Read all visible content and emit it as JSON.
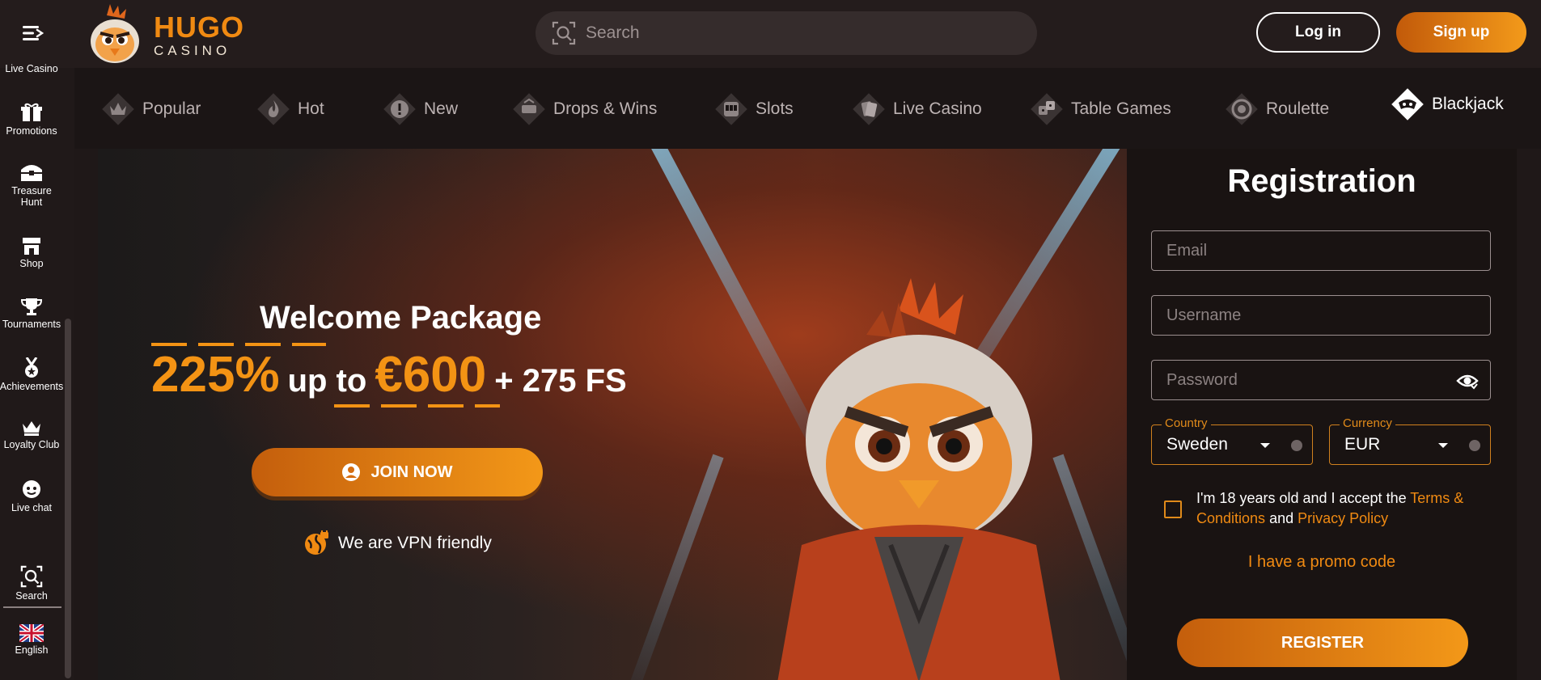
{
  "header": {
    "logo_hugo": "HUGO",
    "logo_casino": "CASINO",
    "search_placeholder": "Search",
    "login_label": "Log in",
    "signup_label": "Sign up"
  },
  "sidebar": {
    "partial_item": "Live Casino",
    "items": [
      {
        "label": "Promotions",
        "icon": "gift-icon"
      },
      {
        "label": "Treasure Hunt",
        "icon": "treasure-chest-icon"
      },
      {
        "label": "Shop",
        "icon": "shop-icon"
      },
      {
        "label": "Tournaments",
        "icon": "trophy-icon"
      },
      {
        "label": "Achievements",
        "icon": "medal-icon"
      },
      {
        "label": "Loyalty Club",
        "icon": "crown-icon"
      },
      {
        "label": "Live chat",
        "icon": "chat-icon"
      },
      {
        "label": "Search",
        "icon": "search-icon"
      },
      {
        "label": "English",
        "icon": "uk-flag-icon"
      }
    ]
  },
  "categories": [
    {
      "label": "Popular",
      "icon": "crown-diamond-icon"
    },
    {
      "label": "Hot",
      "icon": "flame-icon"
    },
    {
      "label": "New",
      "icon": "exclamation-icon"
    },
    {
      "label": "Drops & Wins",
      "icon": "drops-wins-icon"
    },
    {
      "label": "Slots",
      "icon": "slot-machine-icon"
    },
    {
      "label": "Live Casino",
      "icon": "cards-icon"
    },
    {
      "label": "Table Games",
      "icon": "dice-icon"
    },
    {
      "label": "Roulette",
      "icon": "roulette-icon"
    },
    {
      "label": "Blackjack",
      "icon": "blackjack-icon"
    }
  ],
  "hero": {
    "title": "Welcome Package",
    "offer_percent": "225%",
    "offer_up_to": "up to",
    "offer_amount": "€600",
    "offer_fs": "+ 275 FS",
    "join_label": "JOIN NOW",
    "vpn_text": "We are VPN friendly"
  },
  "registration": {
    "title": "Registration",
    "email_placeholder": "Email",
    "username_placeholder": "Username",
    "password_placeholder": "Password",
    "country_legend": "Country",
    "country_value": "Sweden",
    "currency_legend": "Currency",
    "currency_value": "EUR",
    "terms_prefix": "I'm 18 years old and I accept the ",
    "terms_link": "Terms & Conditions",
    "terms_and": " and ",
    "privacy_link": "Privacy Policy",
    "promo_label": "I have a promo code",
    "register_label": "REGISTER"
  },
  "colors": {
    "accent": "#f08a12",
    "background": "#1f1818",
    "header": "#241c1c"
  }
}
